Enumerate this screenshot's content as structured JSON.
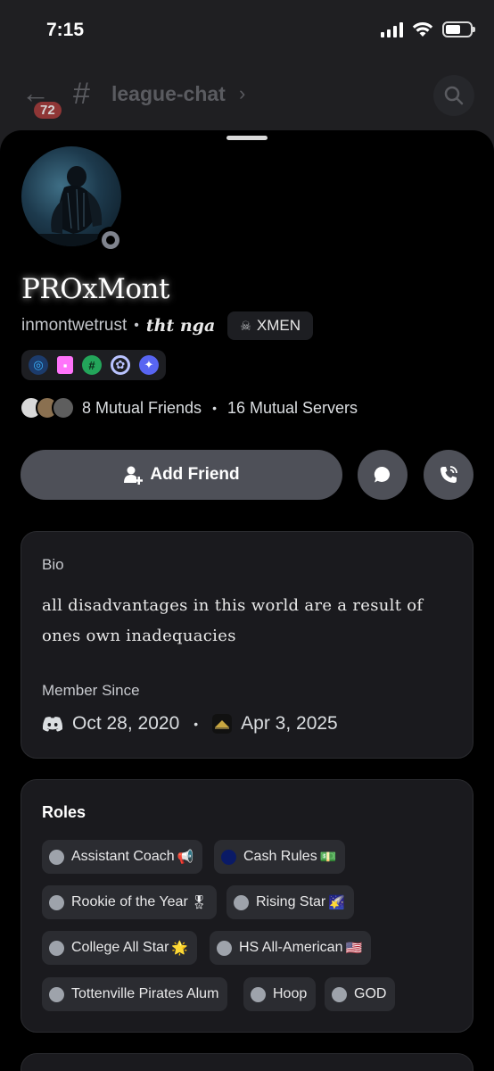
{
  "status_bar": {
    "time": "7:15",
    "battery_level": 0.6
  },
  "channel_header": {
    "back_badge": "72",
    "channel_name": "league-chat",
    "icons": [
      "back-arrow-icon",
      "hash-icon",
      "chevron-right-icon",
      "search-icon"
    ]
  },
  "profile": {
    "display_name": "PROxMont",
    "username": "inmontwetrust",
    "pronouns": "tht nga",
    "clan_tag": "XMEN",
    "badges": [
      "nitro-badge",
      "hypesquad-badge",
      "active-developer-badge",
      "server-booster-badge",
      "quest-badge"
    ],
    "mutual_friends": "8 Mutual Friends",
    "mutual_servers": "16 Mutual Servers"
  },
  "actions": {
    "add_friend": "Add Friend",
    "message_icon": "chat-bubble-icon",
    "call_icon": "phone-call-icon"
  },
  "bio": {
    "title": "Bio",
    "text": "all disadvantages in this world are a result of ones own inadequacies",
    "member_since_title": "Member Since",
    "discord_date": "Oct 28, 2020",
    "server_date": "Apr 3, 2025"
  },
  "roles": {
    "title": "Roles",
    "items": [
      {
        "name": "Assistant Coach",
        "emoji": "📢",
        "color": "#9ea3ab"
      },
      {
        "name": "Cash Rules",
        "emoji": "💵",
        "color": "#0a1a66"
      },
      {
        "name": "Rookie of the Year",
        "emoji": "🎖",
        "color": "#9ea3ab"
      },
      {
        "name": "Rising Star",
        "emoji": "🌠",
        "color": "#9ea3ab"
      },
      {
        "name": "College All Star",
        "emoji": "🌟",
        "color": "#9ea3ab"
      },
      {
        "name": "HS All-American",
        "emoji": "🇺🇸",
        "color": "#9ea3ab"
      },
      {
        "name": "Tottenville Pirates Alum",
        "emoji": "",
        "color": "#9ea3ab"
      },
      {
        "name": "Hoop",
        "emoji": "",
        "color": "#9ea3ab"
      },
      {
        "name": "GOD",
        "emoji": "",
        "color": "#9ea3ab"
      }
    ]
  }
}
